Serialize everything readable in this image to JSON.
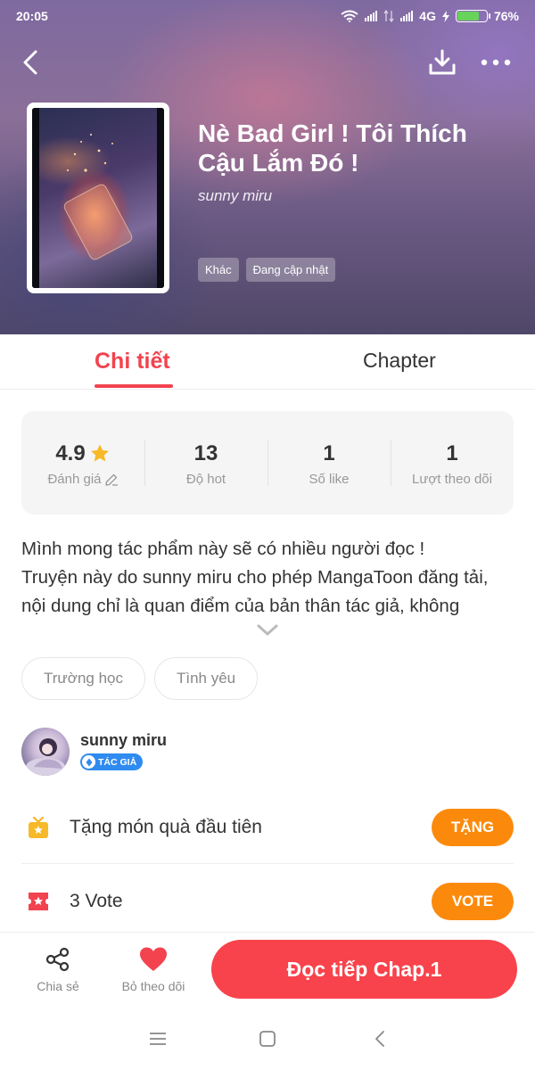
{
  "status_bar": {
    "time": "20:05",
    "network": "4G",
    "battery": "76%",
    "battery_level": 0.76,
    "battery_color": "#67d35b"
  },
  "top_bar": {
    "icons": [
      "back-arrow-icon",
      "download-icon",
      "more-icon"
    ]
  },
  "book": {
    "title": "Nè Bad Girl ! Tôi Thích Cậu Lắm Đó !",
    "author": "sunny miru",
    "tags": [
      "Khác",
      "Đang cập nhật"
    ]
  },
  "tabs": [
    {
      "label": "Chi tiết",
      "active": true
    },
    {
      "label": "Chapter",
      "active": false
    }
  ],
  "stats": [
    {
      "value": "4.9",
      "label": "Đánh giá",
      "icon": "star-icon"
    },
    {
      "value": "13",
      "label": "Độ hot"
    },
    {
      "value": "1",
      "label": "Số like"
    },
    {
      "value": "1",
      "label": "Lượt theo dõi"
    }
  ],
  "description": {
    "lines": [
      "Mình mong tác phẩm này sẽ có nhiều người đọc !",
      "Truyện này do sunny miru cho phép MangaToon đăng tải,",
      "nội dung chỉ là quan điểm của bản thân tác giả, không"
    ]
  },
  "genres": [
    "Trường học",
    "Tình yêu"
  ],
  "author_card": {
    "name": "sunny miru",
    "badge": "TÁC GIẢ"
  },
  "gift": {
    "text": "Tặng món quà đầu tiên",
    "button": "TẶNG"
  },
  "vote": {
    "count": "3",
    "label": "Vote",
    "button": "VOTE"
  },
  "bottom_bar": {
    "share": "Chia sẻ",
    "unfollow": "Bỏ theo dõi",
    "read": "Đọc tiếp Chap.1"
  },
  "colors": {
    "accent": "#f2434f",
    "read_button": "#f8434c",
    "orange_button": "#fb8a0c",
    "star": "#f7b928",
    "author_badge": "#2f8bf0"
  }
}
